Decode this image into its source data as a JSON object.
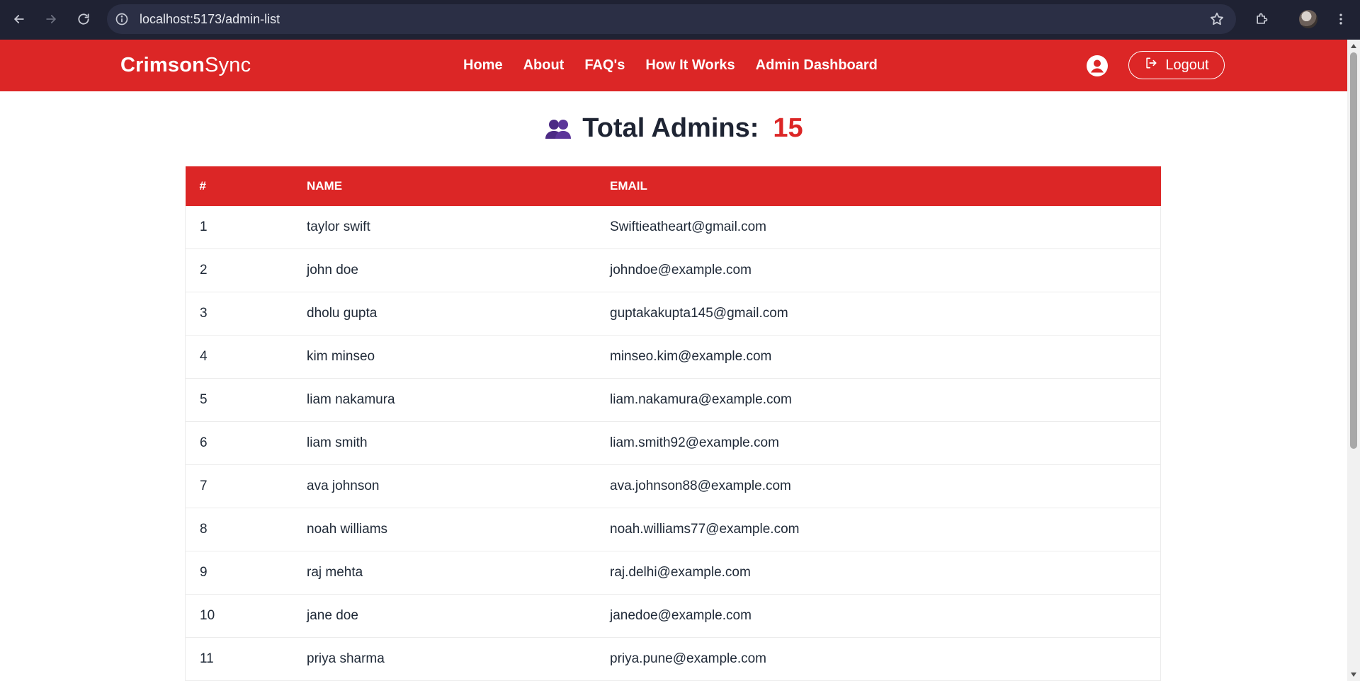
{
  "browser": {
    "url": "localhost:5173/admin-list"
  },
  "navbar": {
    "brand_bold": "Crimson",
    "brand_light": "Sync",
    "links": [
      "Home",
      "About",
      "FAQ's",
      "How It Works",
      "Admin Dashboard"
    ],
    "logout_label": "Logout"
  },
  "page": {
    "heading_label": "Total Admins:",
    "heading_count": "15"
  },
  "table": {
    "columns": [
      "#",
      "NAME",
      "EMAIL"
    ],
    "rows": [
      {
        "num": "1",
        "name": "taylor swift",
        "email": "Swiftieatheart@gmail.com"
      },
      {
        "num": "2",
        "name": "john doe",
        "email": "johndoe@example.com"
      },
      {
        "num": "3",
        "name": "dholu gupta",
        "email": "guptakakupta145@gmail.com"
      },
      {
        "num": "4",
        "name": "kim minseo",
        "email": "minseo.kim@example.com"
      },
      {
        "num": "5",
        "name": "liam nakamura",
        "email": "liam.nakamura@example.com"
      },
      {
        "num": "6",
        "name": "liam smith",
        "email": "liam.smith92@example.com"
      },
      {
        "num": "7",
        "name": "ava johnson",
        "email": "ava.johnson88@example.com"
      },
      {
        "num": "8",
        "name": "noah williams",
        "email": "noah.williams77@example.com"
      },
      {
        "num": "9",
        "name": "raj mehta",
        "email": "raj.delhi@example.com"
      },
      {
        "num": "10",
        "name": "jane doe",
        "email": "janedoe@example.com"
      },
      {
        "num": "11",
        "name": "priya sharma",
        "email": "priya.pune@example.com"
      }
    ]
  },
  "colors": {
    "brand_red": "#dc2626",
    "chrome_bg": "#1f2233",
    "heading_text": "#1e2433",
    "icon_purple": "#4c2a85"
  },
  "icons": {
    "back": "arrow-left-icon",
    "forward": "arrow-right-icon",
    "reload": "reload-icon",
    "site_info": "info-icon",
    "bookmark": "star-icon",
    "extensions": "puzzle-icon",
    "menu": "kebab-menu-icon",
    "user": "user-circle-icon",
    "logout": "logout-icon",
    "admins": "people-icon"
  }
}
